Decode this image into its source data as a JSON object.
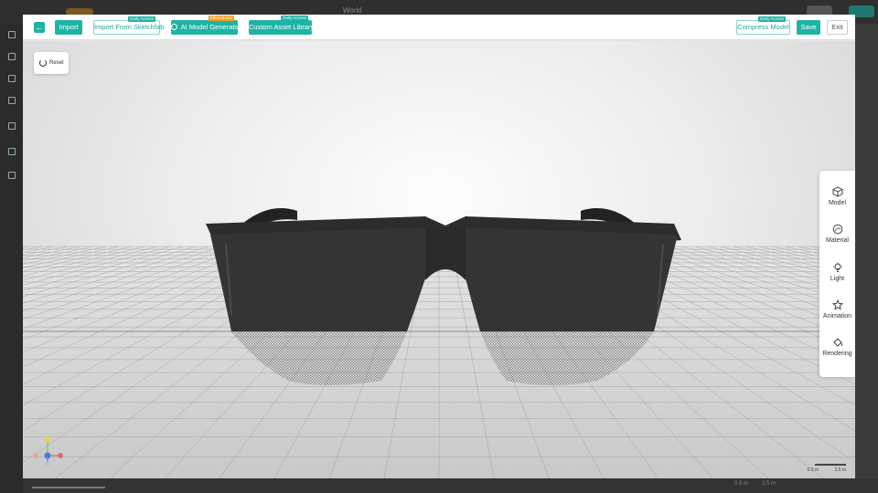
{
  "toolbar": {
    "import": "Import",
    "import_sketchfab": "Import From Sketchfab",
    "ai_generator": "AI Model Generator",
    "custom_assets": "Custom Asset Library",
    "compress": "Compress Model",
    "save": "Save",
    "exit": "Exit",
    "tag_early_access": "Early Access",
    "tag_effect_boost": "Effect Boost"
  },
  "viewport": {
    "reset": "Reset",
    "scale_labels": [
      "0.5 m",
      "2.5 m"
    ]
  },
  "side_panel": {
    "items": [
      {
        "label": "Model",
        "icon": "cube-icon"
      },
      {
        "label": "Material",
        "icon": "material-icon"
      },
      {
        "label": "Light",
        "icon": "lightbulb-icon"
      },
      {
        "label": "Animation",
        "icon": "animation-icon"
      },
      {
        "label": "Rendering",
        "icon": "paint-bucket-icon"
      }
    ]
  },
  "background_app": {
    "title": "World",
    "bottom_labels": [
      "0.5 m",
      "2.5 m"
    ]
  },
  "colors": {
    "accent": "#1fb3a5",
    "tag_orange": "#f0a020",
    "glasses": "#2a2a2a"
  }
}
